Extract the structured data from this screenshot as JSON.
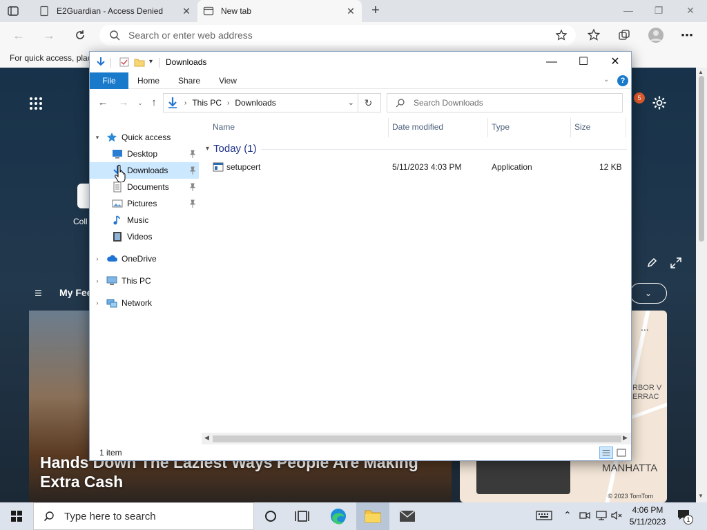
{
  "browser": {
    "tabs": [
      {
        "label": "E2Guardian - Access Denied"
      },
      {
        "label": "New tab"
      }
    ],
    "address_placeholder": "Search or enter web address",
    "favorites_bar_text": "For quick access, place"
  },
  "newtab_page": {
    "collab_label": "Coll",
    "feed_label": "My Fee",
    "headline": "Hands Down The Laziest Ways People Are Making Extra Cash",
    "map_labels": [
      "RBOR V",
      "ERRAC",
      "MANHATTA"
    ],
    "map_copyright": "© 2023 TomTom",
    "notification_count": "5",
    "more_label": "..."
  },
  "explorer": {
    "title": "Downloads",
    "ribbon_tabs": [
      "File",
      "Home",
      "Share",
      "View"
    ],
    "breadcrumbs": [
      "This PC",
      "Downloads"
    ],
    "search_placeholder": "Search Downloads",
    "nav": {
      "quick_access": "Quick access",
      "items": [
        "Desktop",
        "Downloads",
        "Documents",
        "Pictures",
        "Music",
        "Videos"
      ],
      "onedrive": "OneDrive",
      "this_pc": "This PC",
      "network": "Network"
    },
    "columns": [
      "Name",
      "Date modified",
      "Type",
      "Size"
    ],
    "group_label": "Today (1)",
    "files": [
      {
        "name": "setupcert",
        "date": "5/11/2023 4:03 PM",
        "type": "Application",
        "size": "12 KB"
      }
    ],
    "status": "1 item"
  },
  "taskbar": {
    "search_placeholder": "Type here to search",
    "time": "4:06 PM",
    "date": "5/11/2023",
    "notification_badge": "1"
  },
  "colors": {
    "ribbon_file": "#1979ca",
    "selection": "#cce8ff",
    "group_header": "#1e3287"
  }
}
